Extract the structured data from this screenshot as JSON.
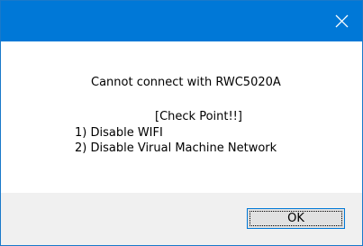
{
  "window": {
    "title": "",
    "title_bar_color": "#0078d7"
  },
  "title_bar": {
    "close_icon": "close-icon"
  },
  "message": {
    "main": "Cannot connect with RWC5020A",
    "check_point": "[Check Point!!]",
    "item1": "1) Disable WIFI",
    "item2": "2) Disable Virual Machine Network"
  },
  "buttons": {
    "ok_label": "OK"
  }
}
